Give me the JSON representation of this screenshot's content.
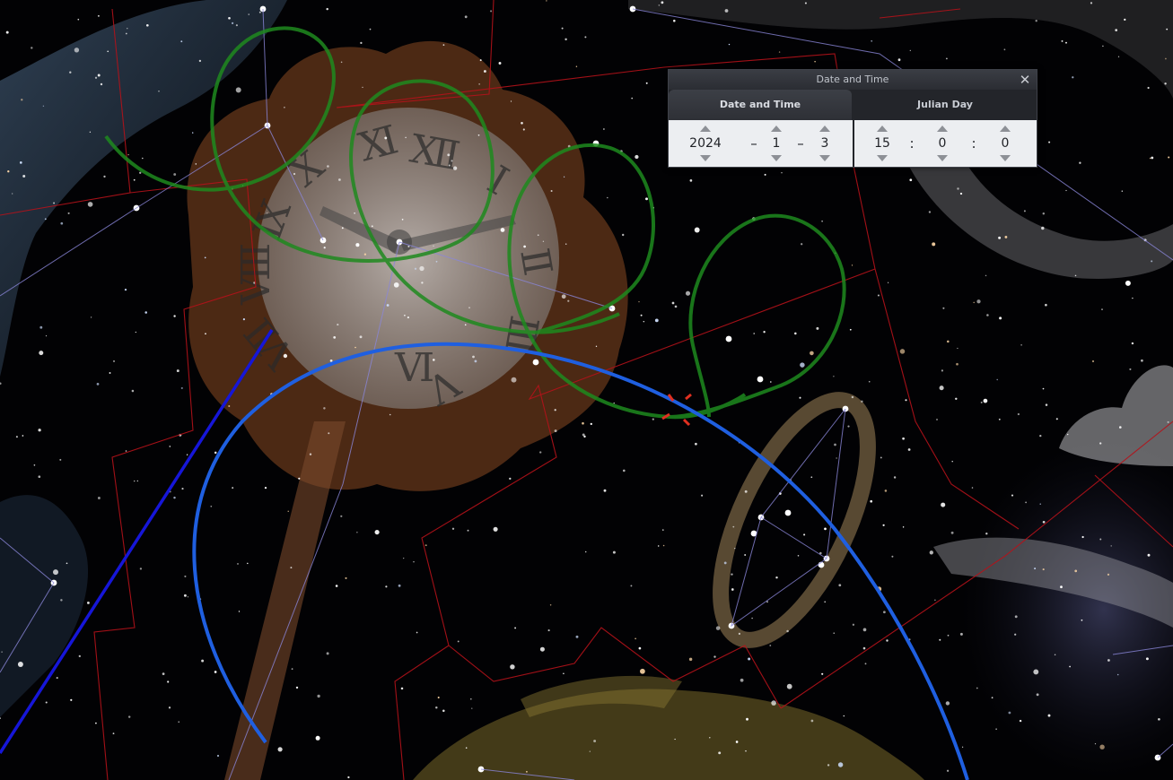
{
  "dialog": {
    "title": "Date and Time",
    "close_glyph": "✕",
    "tabs": [
      {
        "label": "Date and Time",
        "active": true
      },
      {
        "label": "Julian Day",
        "active": false
      }
    ],
    "date": {
      "year": "2024",
      "month": "1",
      "day": "3",
      "separator": "–"
    },
    "time": {
      "hour": "15",
      "minute": "0",
      "second": "0",
      "separator": ":"
    }
  },
  "sky": {
    "colors": {
      "ecliptic_or_horizon_arc": "#1f5fe0",
      "meridian_line": "#1616d8",
      "planet_loop_trails": "#1e8a1e",
      "constellation_boundaries": "#b4121a",
      "constellation_lines": "#8a86d8",
      "artwork_tint": "#8a5a30"
    },
    "icons": [
      "close-icon",
      "spin-up-icon",
      "spin-down-icon"
    ]
  }
}
